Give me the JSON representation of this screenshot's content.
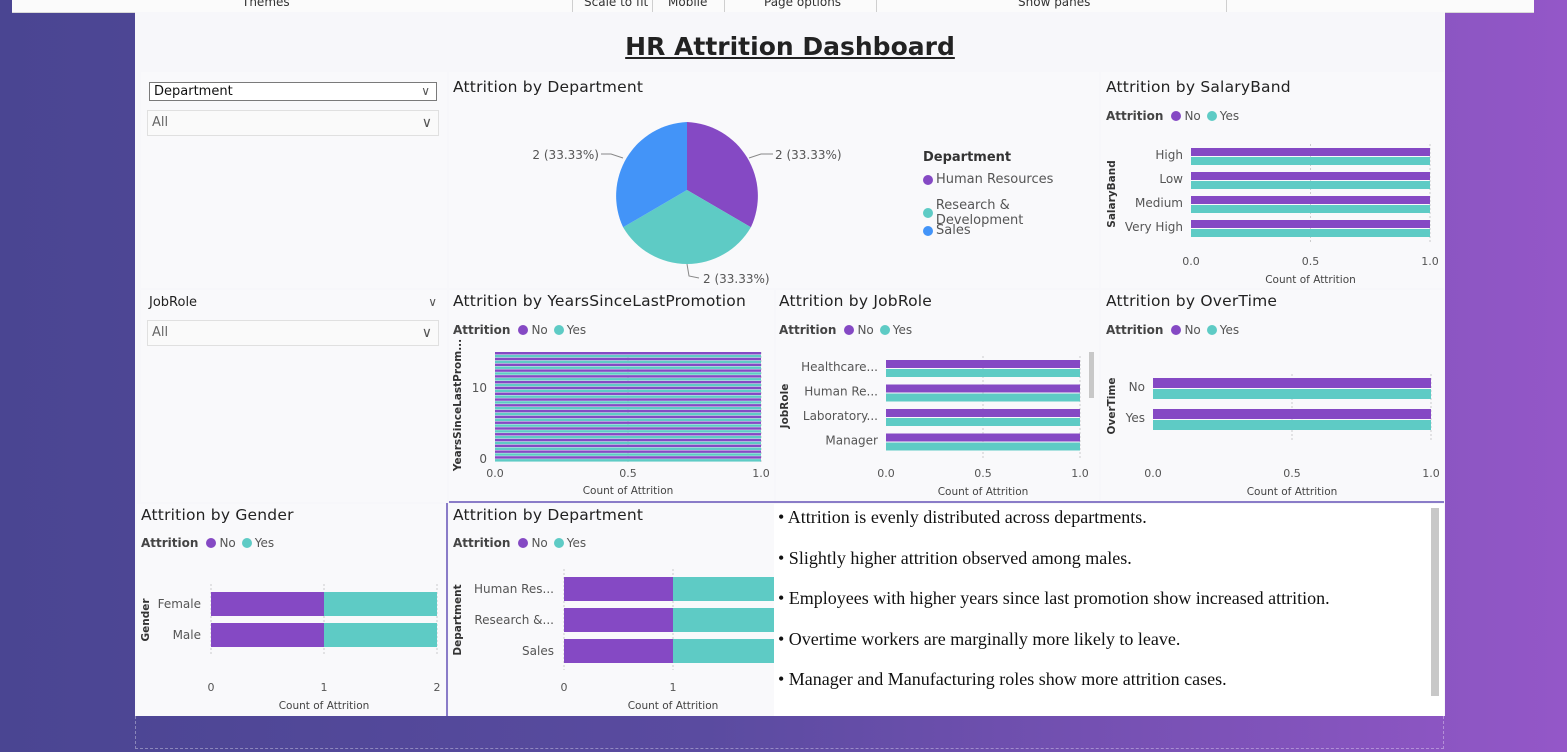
{
  "toolbar": {
    "items": [
      "Themes",
      "Scale to fit",
      "Mobile",
      "Page options",
      "Show panes"
    ]
  },
  "dashboard_title": "HR Attrition Dashboard",
  "slicers": [
    {
      "title": "Department",
      "value": "All"
    },
    {
      "title": "JobRole",
      "value": "All"
    }
  ],
  "legend_common": {
    "field": "Attrition",
    "no": "No",
    "yes": "Yes"
  },
  "colors": {
    "no": "#8549c4",
    "yes": "#5ecbc5",
    "sales": "#4394f8"
  },
  "icons": [
    "chevron-down-icon"
  ],
  "charts": {
    "pie_dept": {
      "title": "Attrition by Department",
      "legend_title": "Department",
      "labels": [
        "Human Resources",
        "Research & Development",
        "Sales"
      ],
      "slice_labels": [
        "2 (33.33%)",
        "2 (33.33%)",
        "2 (33.33%)"
      ]
    },
    "salary": {
      "title": "Attrition by SalaryBand",
      "ylabel": "SalaryBand",
      "xlabel": "Count of Attrition",
      "categories": [
        "High",
        "Low",
        "Medium",
        "Very High"
      ],
      "ticks": [
        "0.0",
        "0.5",
        "1.0"
      ]
    },
    "years": {
      "title": "Attrition by YearsSinceLastPromotion",
      "ylabel": "YearsSinceLastProm...",
      "xlabel": "Count of Attrition",
      "yticks": [
        "10",
        "0"
      ],
      "ticks": [
        "0.0",
        "0.5",
        "1.0"
      ]
    },
    "jobrole": {
      "title": "Attrition by JobRole",
      "ylabel": "JobRole",
      "xlabel": "Count of Attrition",
      "categories": [
        "Healthcare...",
        "Human Re...",
        "Laboratory...",
        "Manager"
      ],
      "ticks": [
        "0.0",
        "0.5",
        "1.0"
      ]
    },
    "overtime": {
      "title": "Attrition by OverTime",
      "ylabel": "OverTime",
      "xlabel": "Count of Attrition",
      "categories": [
        "No",
        "Yes"
      ],
      "ticks": [
        "0.0",
        "0.5",
        "1.0"
      ]
    },
    "gender": {
      "title": "Attrition by Gender",
      "ylabel": "Gender",
      "xlabel": "Count of Attrition",
      "categories": [
        "Female",
        "Male"
      ],
      "ticks": [
        "0",
        "1",
        "2"
      ]
    },
    "dept_bar": {
      "title": "Attrition by Department",
      "ylabel": "Department",
      "xlabel": "Count of Attrition",
      "categories": [
        "Human Res...",
        "Research &...",
        "Sales"
      ],
      "ticks": [
        "0",
        "1"
      ]
    }
  },
  "insights": [
    "• Attrition is evenly distributed across departments.",
    "• Slightly higher attrition observed among males.",
    "• Employees with higher years since last promotion show increased attrition.",
    "• Overtime workers are marginally more likely to leave.",
    "• Manager and Manufacturing roles show more attrition cases."
  ],
  "chart_data": [
    {
      "type": "pie",
      "title": "Attrition by Department",
      "categories": [
        "Human Resources",
        "Research & Development",
        "Sales"
      ],
      "values": [
        2,
        2,
        2
      ]
    },
    {
      "type": "bar",
      "title": "Attrition by SalaryBand",
      "categories": [
        "High",
        "Low",
        "Medium",
        "Very High"
      ],
      "series": [
        {
          "name": "No",
          "values": [
            1,
            1,
            1,
            1
          ]
        },
        {
          "name": "Yes",
          "values": [
            1,
            1,
            1,
            1
          ]
        }
      ],
      "xlabel": "Count of Attrition",
      "ylabel": "SalaryBand",
      "xlim": [
        0,
        1
      ]
    },
    {
      "type": "bar",
      "title": "Attrition by YearsSinceLastPromotion",
      "series": [
        {
          "name": "No",
          "values": [
            1
          ]
        },
        {
          "name": "Yes",
          "values": [
            1
          ]
        }
      ],
      "xlabel": "Count of Attrition",
      "ylabel": "YearsSinceLastPromotion",
      "xlim": [
        0,
        1
      ],
      "ylim": [
        0,
        15
      ]
    },
    {
      "type": "bar",
      "title": "Attrition by JobRole",
      "categories": [
        "Healthcare...",
        "Human Re...",
        "Laboratory...",
        "Manager"
      ],
      "series": [
        {
          "name": "No",
          "values": [
            1,
            1,
            1,
            1
          ]
        },
        {
          "name": "Yes",
          "values": [
            1,
            1,
            1,
            1
          ]
        }
      ],
      "xlabel": "Count of Attrition",
      "ylabel": "JobRole",
      "xlim": [
        0,
        1
      ]
    },
    {
      "type": "bar",
      "title": "Attrition by OverTime",
      "categories": [
        "No",
        "Yes"
      ],
      "series": [
        {
          "name": "No",
          "values": [
            1,
            1
          ]
        },
        {
          "name": "Yes",
          "values": [
            1,
            1
          ]
        }
      ],
      "xlabel": "Count of Attrition",
      "ylabel": "OverTime",
      "xlim": [
        0,
        1
      ]
    },
    {
      "type": "bar",
      "title": "Attrition by Gender",
      "categories": [
        "Female",
        "Male"
      ],
      "series": [
        {
          "name": "No",
          "values": [
            1,
            1
          ]
        },
        {
          "name": "Yes",
          "values": [
            1,
            1
          ]
        }
      ],
      "stacked": true,
      "xlabel": "Count of Attrition",
      "ylabel": "Gender",
      "xlim": [
        0,
        2
      ]
    },
    {
      "type": "bar",
      "title": "Attrition by Department",
      "categories": [
        "Human Res...",
        "Research &...",
        "Sales"
      ],
      "series": [
        {
          "name": "No",
          "values": [
            1,
            1,
            1
          ]
        },
        {
          "name": "Yes",
          "values": [
            1,
            1,
            1
          ]
        }
      ],
      "stacked": true,
      "xlabel": "Count of Attrition",
      "ylabel": "Department"
    }
  ]
}
